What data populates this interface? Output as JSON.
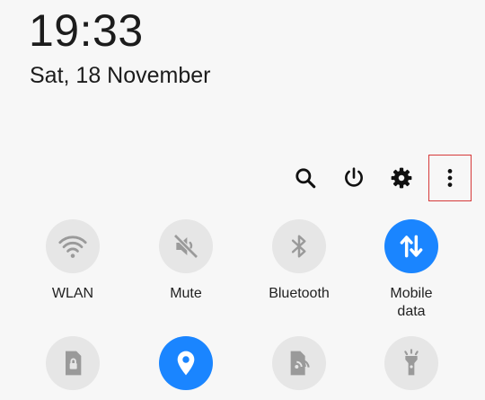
{
  "status": {
    "time": "19:33",
    "date": "Sat, 18 November"
  },
  "toolbar": {
    "icons": [
      "search-icon",
      "power-icon",
      "gear-icon",
      "more-vertical-icon"
    ],
    "highlight_color": "#d63a3a"
  },
  "quick_tiles": [
    {
      "label": "WLAN",
      "icon": "wifi-icon",
      "active": false
    },
    {
      "label": "Mute",
      "icon": "mute-icon",
      "active": false
    },
    {
      "label": "Bluetooth",
      "icon": "bluetooth-icon",
      "active": false
    },
    {
      "label": "Mobile\ndata",
      "icon": "mobile-data-icon",
      "active": true
    },
    {
      "label": "",
      "icon": "portrait-lock-icon",
      "active": false
    },
    {
      "label": "",
      "icon": "location-icon",
      "active": true
    },
    {
      "label": "",
      "icon": "share-icon",
      "active": false
    },
    {
      "label": "",
      "icon": "flashlight-icon",
      "active": false
    }
  ],
  "colors": {
    "accent": "#1a85ff",
    "tile_inactive": "#e6e6e6",
    "background": "#f7f7f7"
  }
}
